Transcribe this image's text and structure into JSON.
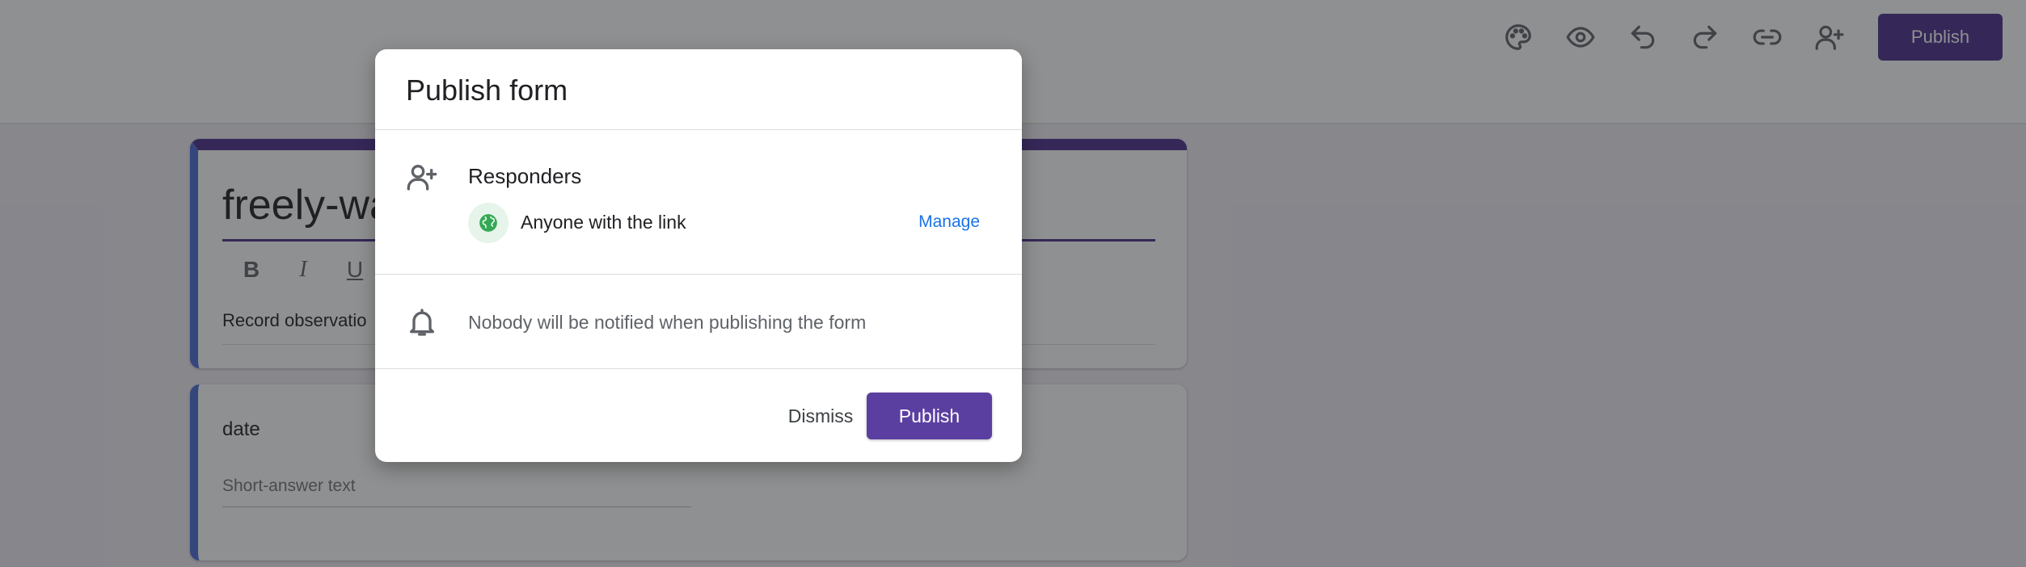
{
  "topbar": {
    "icons": [
      "palette-icon",
      "eye-icon",
      "undo-icon",
      "redo-icon",
      "link-icon",
      "add-person-icon"
    ],
    "publish_label": "Publish"
  },
  "form": {
    "title": "freely-wa",
    "format_buttons": [
      "B",
      "I",
      "U"
    ],
    "description": "Record observatio",
    "question": {
      "title": "date",
      "placeholder": "Short-answer text"
    }
  },
  "dialog": {
    "title": "Publish form",
    "responders": {
      "heading": "Responders",
      "value": "Anyone with the link",
      "manage_label": "Manage"
    },
    "notification": "Nobody will be notified when publishing the form",
    "dismiss_label": "Dismiss",
    "publish_label": "Publish"
  },
  "colors": {
    "accent": "#4a2e8f",
    "primary_button": "#5b3fa0",
    "link": "#1a73e8",
    "card_accent": "#4b6bd6",
    "globe_bg": "#e6f4ea",
    "globe": "#34a853"
  }
}
